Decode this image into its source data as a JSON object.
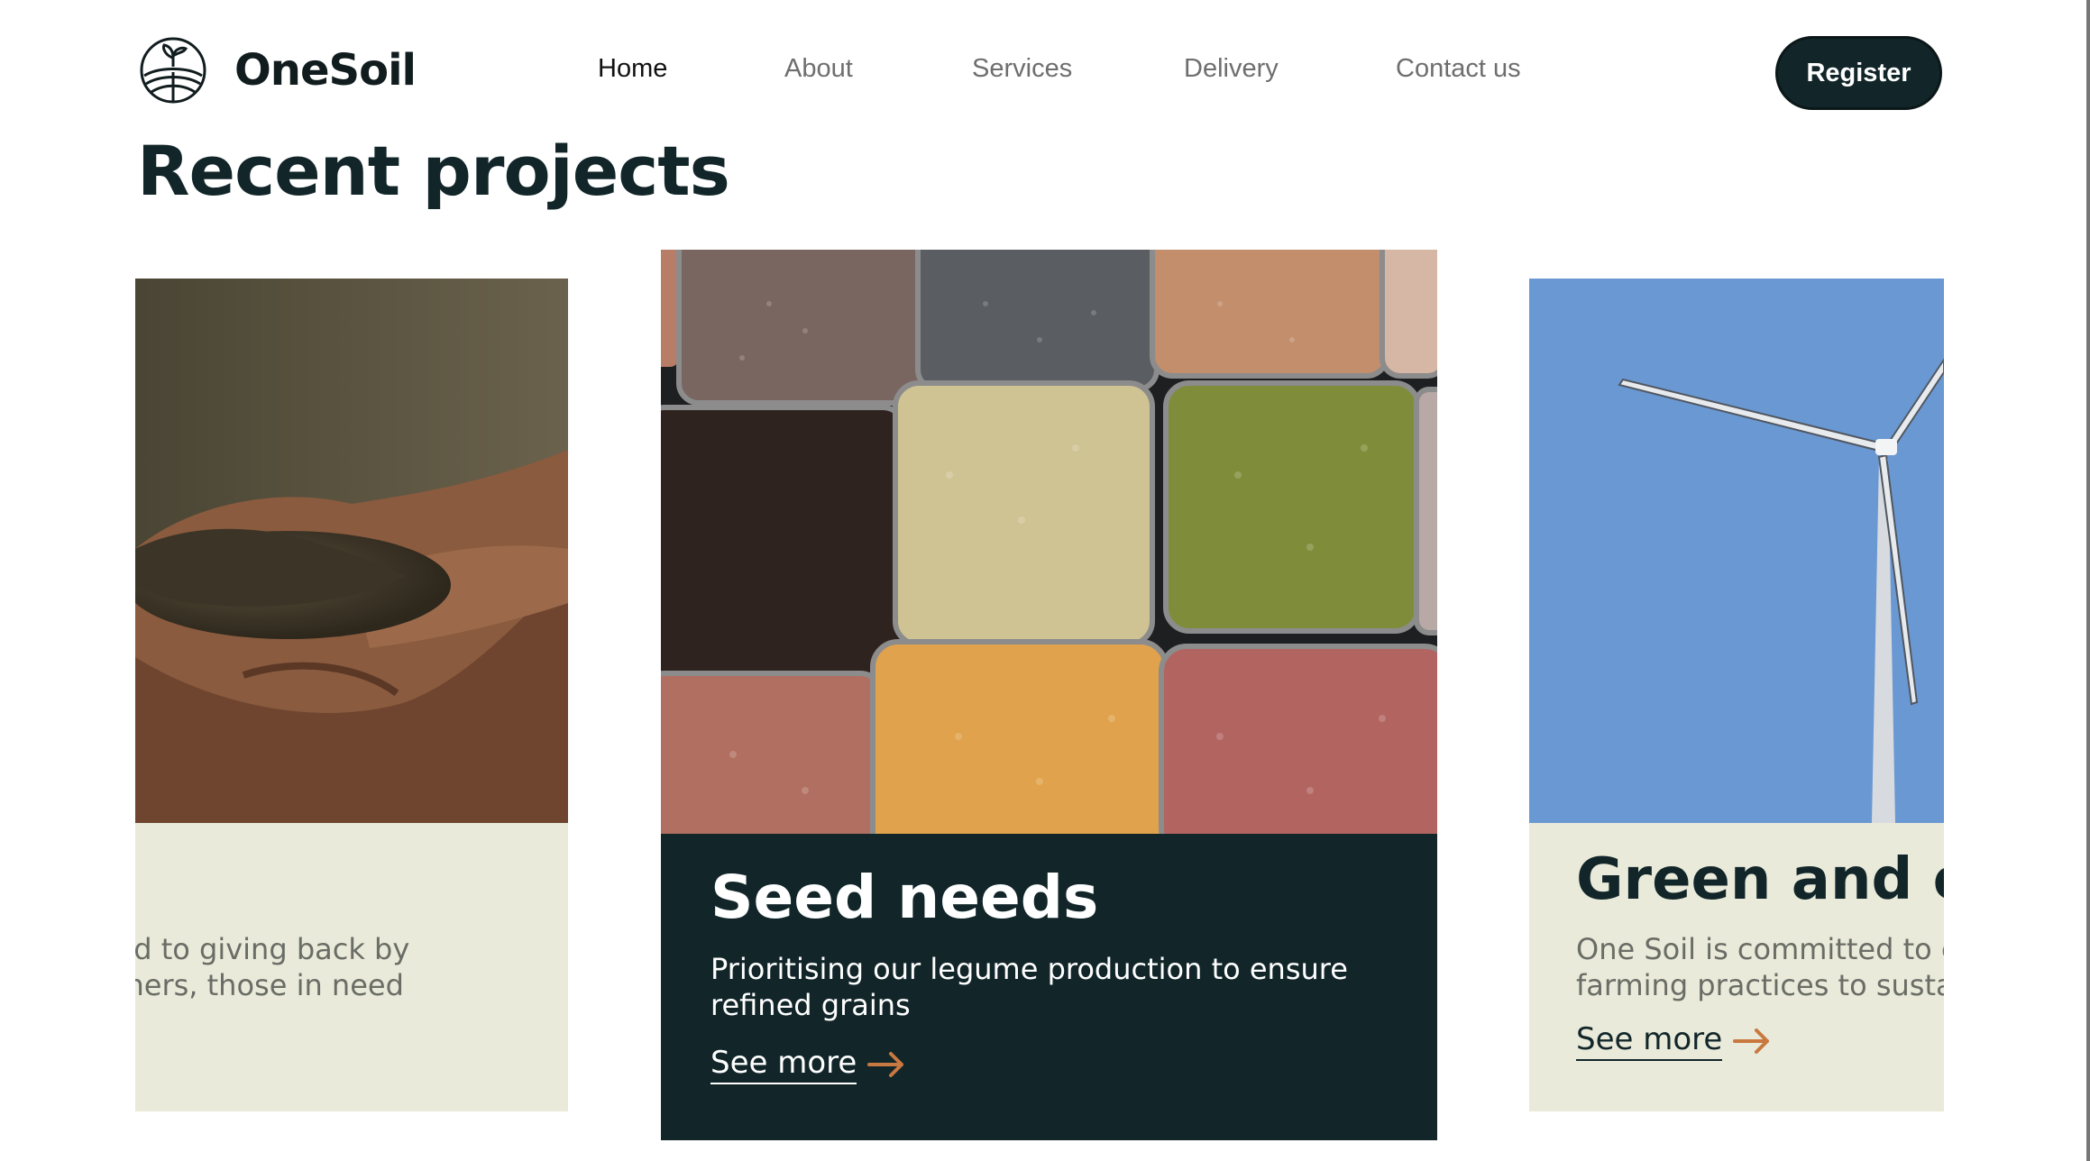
{
  "brand": {
    "name": "OneSoil",
    "logo_icon": "sprout-field-logo-icon"
  },
  "nav": {
    "items": [
      {
        "label": "Home",
        "active": true
      },
      {
        "label": "About",
        "active": false
      },
      {
        "label": "Services",
        "active": false
      },
      {
        "label": "Delivery",
        "active": false
      },
      {
        "label": "Contact us",
        "active": false
      }
    ]
  },
  "header": {
    "register_label": "Register"
  },
  "section": {
    "title": "Recent projects"
  },
  "cards": [
    {
      "title": "",
      "text_line1": "ted to giving back by",
      "text_line2": "rmers, those in need",
      "image": "hands-holding-soil"
    },
    {
      "title": "Seed needs",
      "text": "Prioritising our legume production to ensure refined grains",
      "see_more": "See more",
      "image": "grain-trays"
    },
    {
      "title": "Green and cle",
      "text_line1": "One Soil is committed to ec",
      "text_line2": "farming practices to sustain",
      "see_more": "See more",
      "image": "wind-turbine"
    }
  ],
  "colors": {
    "primary": "#12262a",
    "card_light": "#e9ead9",
    "accent_arrow": "#c9783f",
    "sky": "#6a98d3"
  }
}
